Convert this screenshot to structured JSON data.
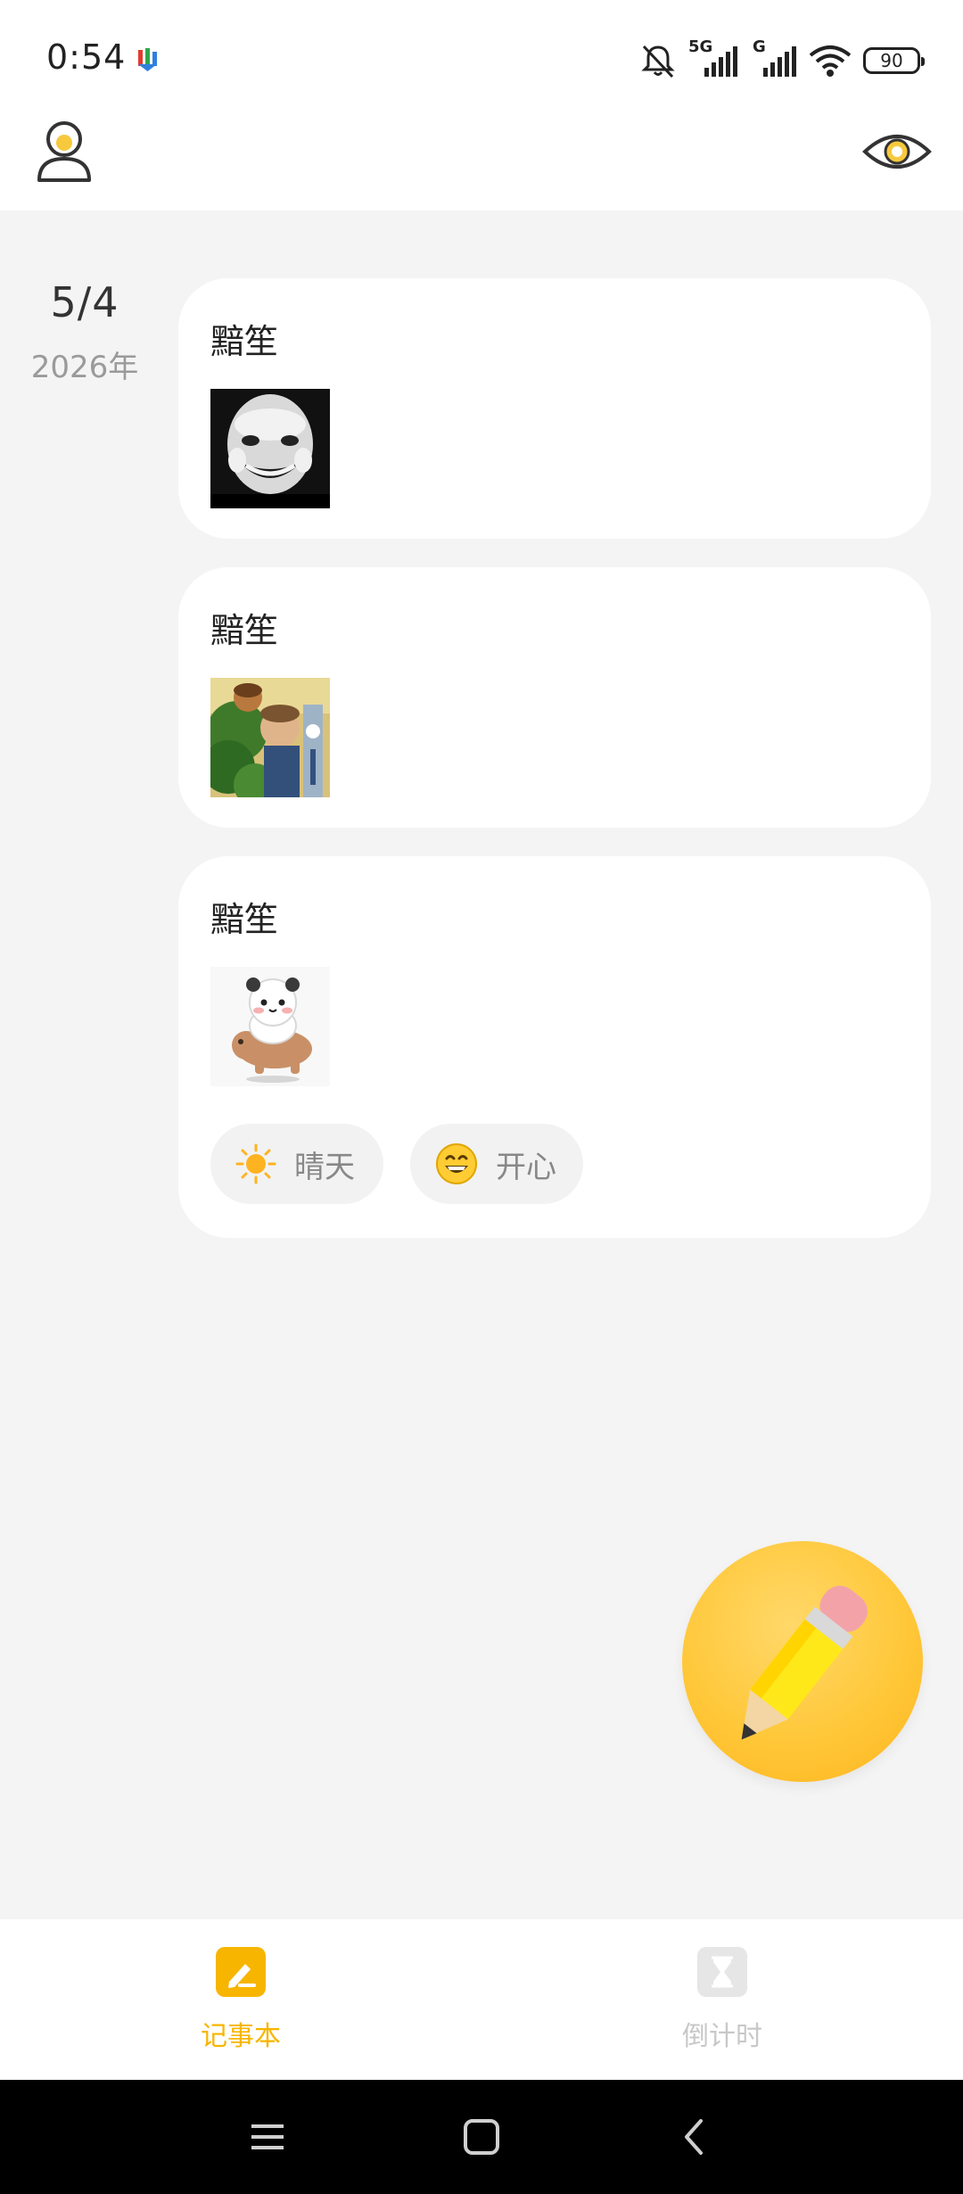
{
  "status_bar": {
    "time": "0:54",
    "battery": "90",
    "network_labels": [
      "5G",
      "G"
    ]
  },
  "header": {
    "profile_icon": "user-icon",
    "visibility_icon": "eye-icon"
  },
  "date_group": {
    "day": "5/4",
    "year": "2026年"
  },
  "entries": [
    {
      "title": "黯笙",
      "thumbnail": "face-sticker-image"
    },
    {
      "title": "黯笙",
      "thumbnail": "cartoon-scene-image"
    },
    {
      "title": "黯笙",
      "thumbnail": "panda-capybara-sticker-image",
      "weather": {
        "icon": "sun-icon",
        "label": "晴天"
      },
      "mood": {
        "icon": "grinning-face-icon",
        "label": "开心"
      }
    }
  ],
  "fab": {
    "icon": "pencil-icon"
  },
  "bottom_nav": {
    "items": [
      {
        "label": "记事本",
        "active": true,
        "icon": "notebook-icon"
      },
      {
        "label": "倒计时",
        "active": false,
        "icon": "hourglass-icon"
      }
    ]
  },
  "colors": {
    "accent": "#f7b500",
    "inactive": "#c8c8c8",
    "background": "#f4f4f4"
  }
}
